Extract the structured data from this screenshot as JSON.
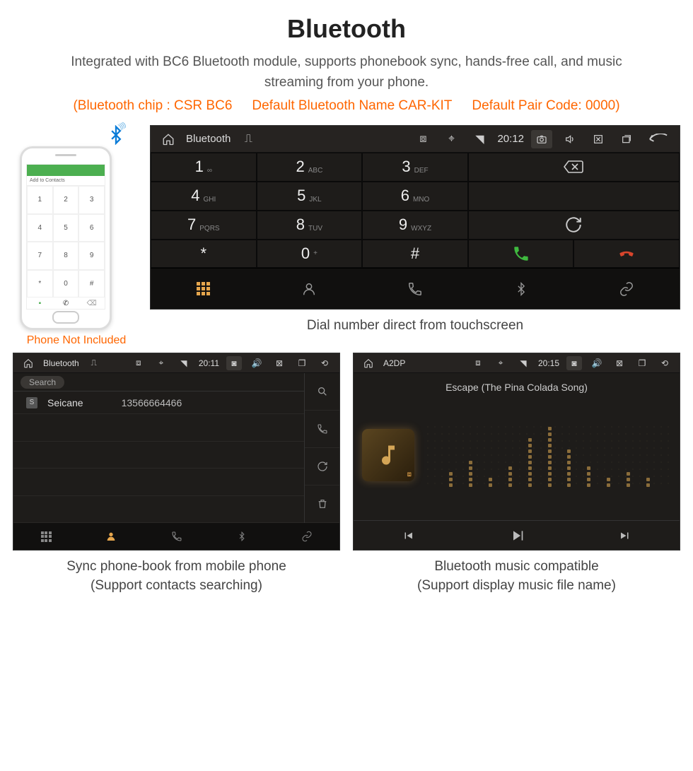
{
  "title": "Bluetooth",
  "subtitle": "Integrated with BC6 Bluetooth module, supports phonebook sync, hands-free call, and music streaming from your phone.",
  "specs": {
    "chip": "(Bluetooth chip : CSR BC6",
    "name": "Default Bluetooth Name CAR-KIT",
    "pair": "Default Pair Code: 0000)"
  },
  "phone": {
    "add_contacts": "Add to Contacts",
    "caption": "Phone Not Included",
    "keys": [
      "1",
      "2",
      "3",
      "4",
      "5",
      "6",
      "7",
      "8",
      "9",
      "*",
      "0",
      "#"
    ]
  },
  "main_unit": {
    "app_name": "Bluetooth",
    "time": "20:12",
    "keypad": [
      {
        "n": "1",
        "s": "∞"
      },
      {
        "n": "2",
        "s": "ABC"
      },
      {
        "n": "3",
        "s": "DEF"
      },
      {
        "n": "4",
        "s": "GHI"
      },
      {
        "n": "5",
        "s": "JKL"
      },
      {
        "n": "6",
        "s": "MNO"
      },
      {
        "n": "7",
        "s": "PQRS"
      },
      {
        "n": "8",
        "s": "TUV"
      },
      {
        "n": "9",
        "s": "WXYZ"
      },
      {
        "n": "*",
        "s": ""
      },
      {
        "n": "0",
        "s": "+"
      },
      {
        "n": "#",
        "s": ""
      }
    ],
    "caption": "Dial number direct from touchscreen"
  },
  "contacts_unit": {
    "app_name": "Bluetooth",
    "time": "20:11",
    "search": "Search",
    "contact": {
      "badge": "S",
      "name": "Seicane",
      "number": "13566664466"
    },
    "caption_l1": "Sync phone-book from mobile phone",
    "caption_l2": "(Support contacts searching)"
  },
  "music_unit": {
    "app_name": "A2DP",
    "time": "20:15",
    "song": "Escape (The Pina Colada Song)",
    "caption_l1": "Bluetooth music compatible",
    "caption_l2": "(Support display music file name)"
  }
}
